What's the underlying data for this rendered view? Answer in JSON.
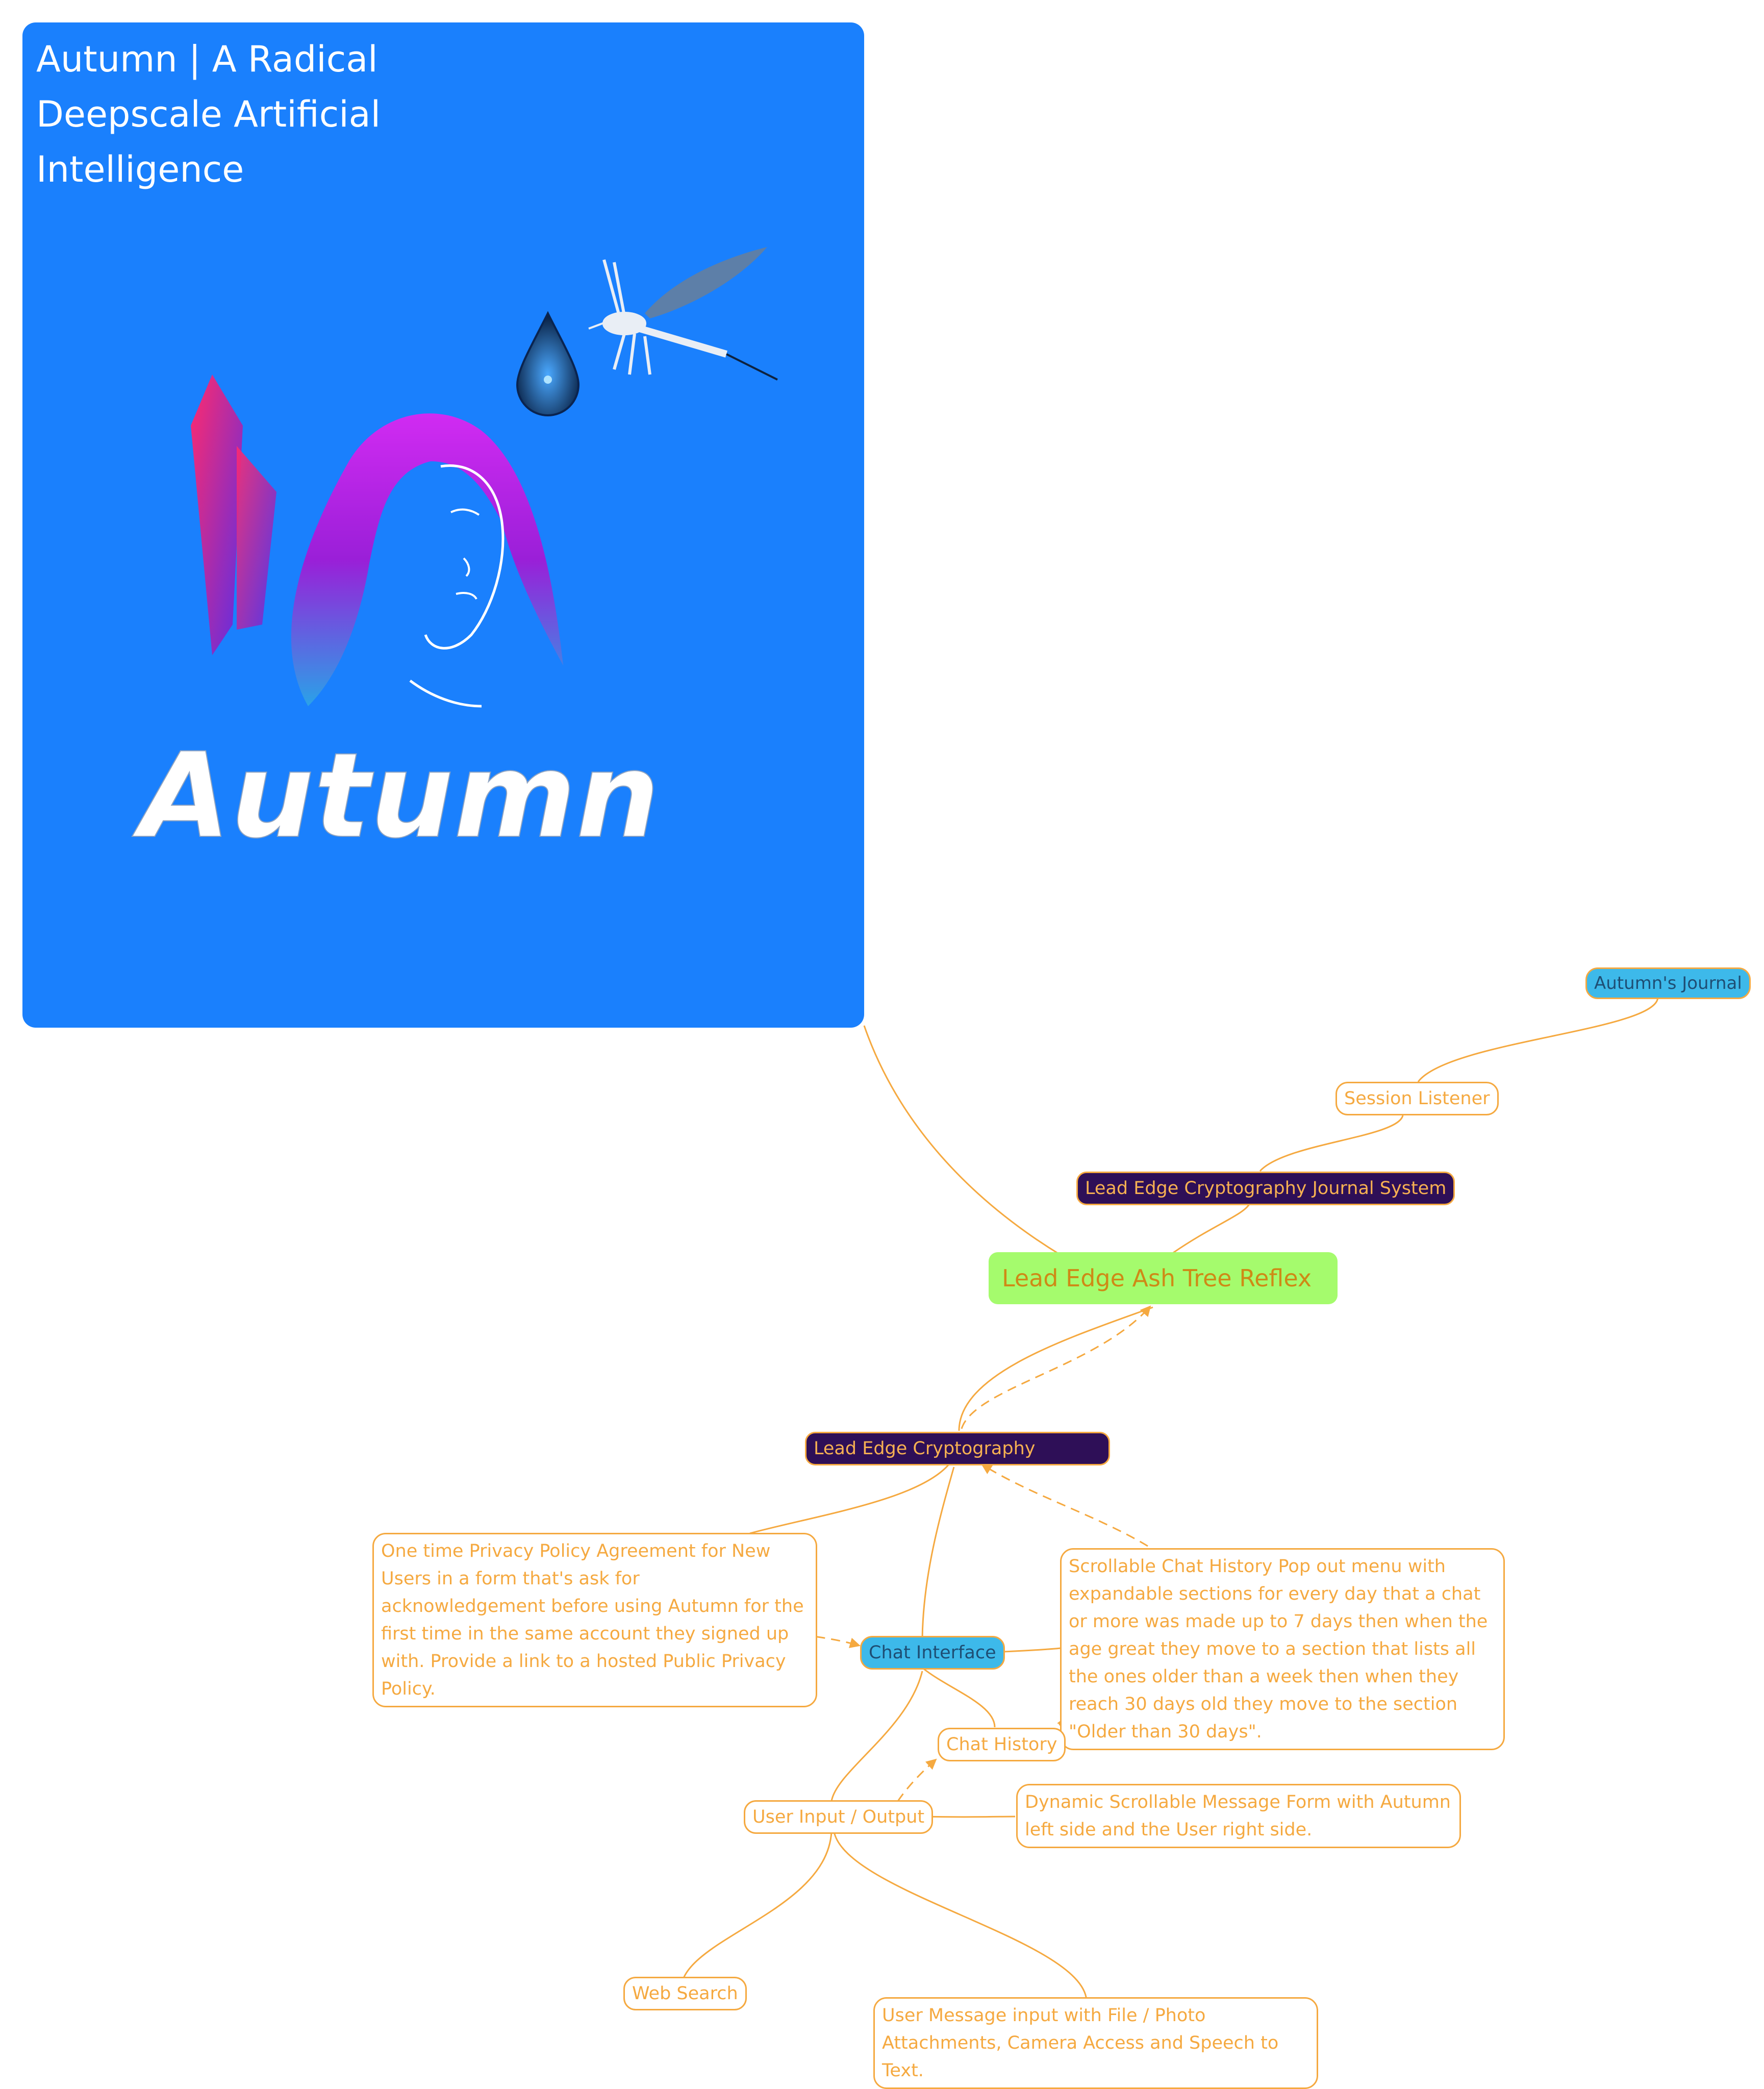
{
  "image_card": {
    "title": "Autumn | A Radical Deepscale Artificial Intelligence",
    "logo_text": "Autumn"
  },
  "nodes": {
    "root": "Lead Edge Ash Tree Reflex",
    "journal_system": "Lead Edge Cryptography Journal System",
    "session_listener": "Session Listener",
    "autumns_journal": "Autumn's Journal",
    "lead_edge_cryptography": "Lead Edge Cryptography",
    "privacy_policy": "One time Privacy Policy Agreement for New Users in a form that's ask for acknowledgement before using Autumn for the first time in the same account they signed up with. Provide a link to a hosted Public Privacy Policy.",
    "chat_history_menu": "Scrollable Chat History Pop out menu with expandable sections for every day that a chat or more was made up to 7 days then when the age great they move to a section that lists all the ones older than a week then when they reach 30 days old they move to the section \"Older than 30 days\".",
    "chat_interface": "Chat Interface",
    "chat_history": "Chat History",
    "user_input_output": "User Input / Output",
    "dynamic_message_form": "Dynamic Scrollable Message Form with Autumn left side and the User right side.",
    "web_search": "Web Search",
    "user_message_input": "User Message input with File / Photo Attachments, Camera Access and Speech to Text."
  },
  "colors": {
    "card_blue": "#1a80fd",
    "link_orange": "#f5a940",
    "root_green": "#a5fb6d",
    "node_blue": "#3db9ea",
    "node_dark": "#2e0f57"
  }
}
